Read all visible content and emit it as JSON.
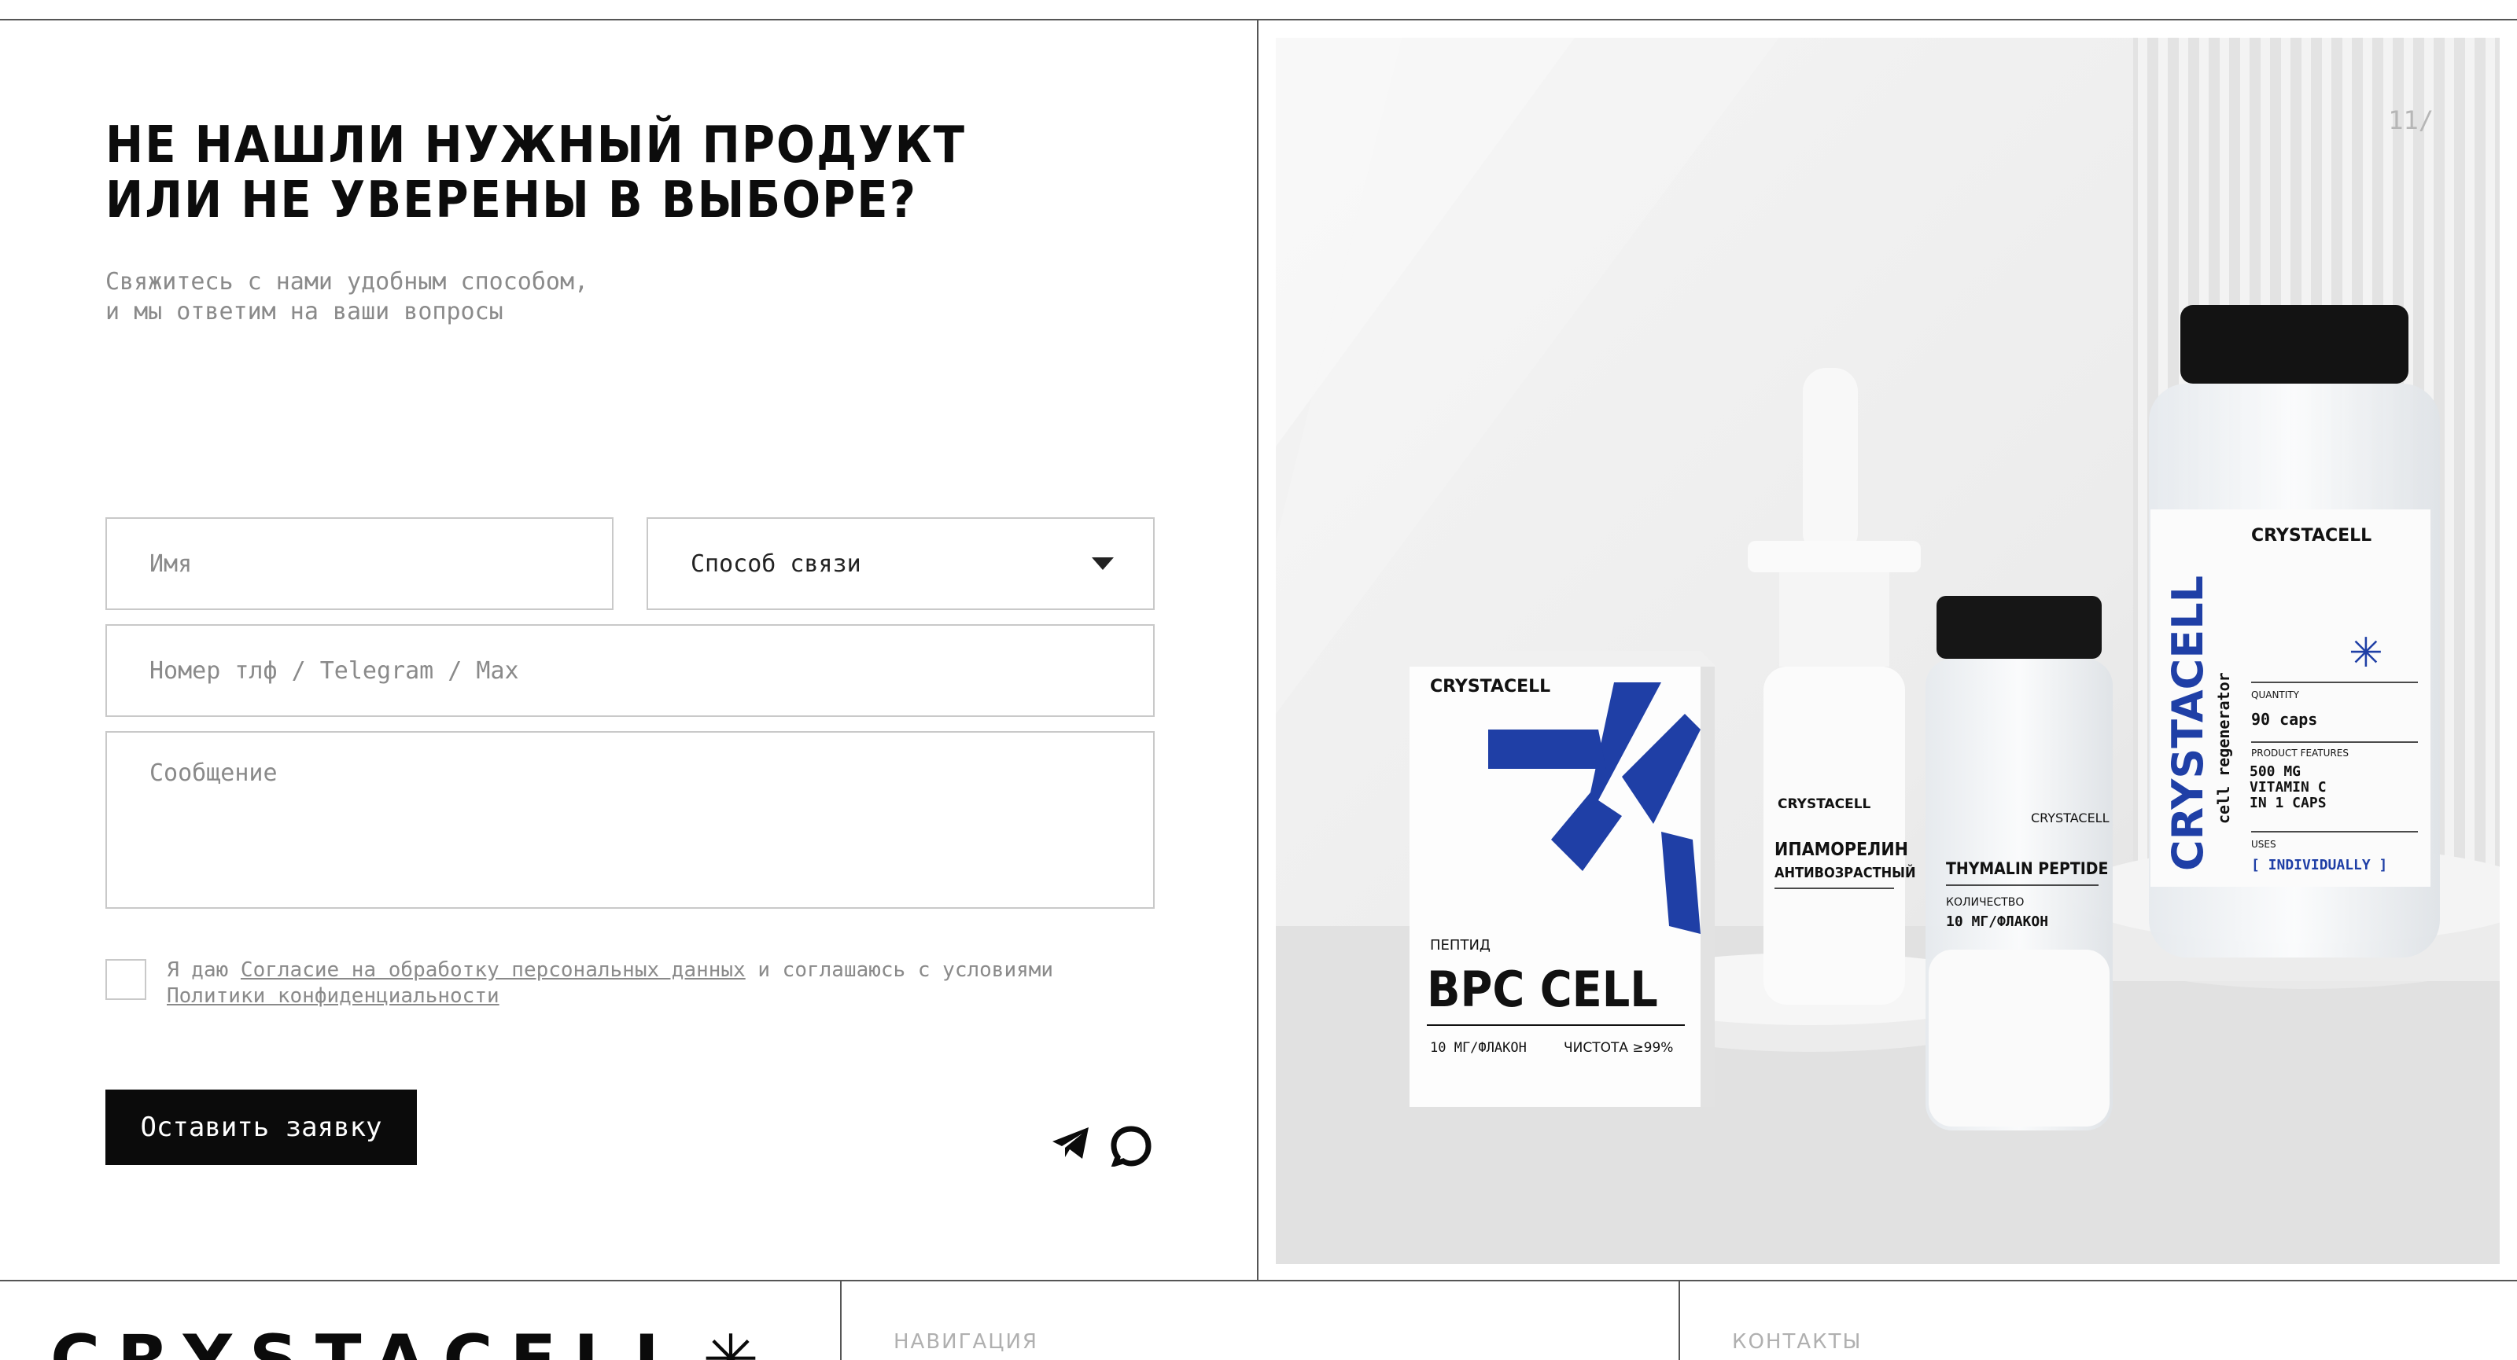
{
  "form": {
    "title_line1": "НЕ НАШЛИ НУЖНЫЙ ПРОДУКТ",
    "title_line2": "ИЛИ НЕ УВЕРЕНЫ В ВЫБОРЕ?",
    "subtitle_line1": "Свяжитесь с нами удобным способом,",
    "subtitle_line2": "и мы ответим на ваши вопросы",
    "name_placeholder": "Имя",
    "contact_method": "Способ связи",
    "phone_placeholder": "Номер тлф / Telegram / Max",
    "message_placeholder": "Сообщение",
    "consent_prefix": "Я даю ",
    "consent_link": "Согласие на обработку персональных данных",
    "consent_middle": " и соглашаюсь с условиями ",
    "privacy_link": "Политики конфиденциальности",
    "submit_label": "Оставить заявку"
  },
  "hero": {
    "page_number": "11/",
    "products": {
      "box_brand": "CRYSTACELL",
      "box_type": "ПЕПТИД",
      "box_name": "BPC CELL",
      "box_dose": "10 МГ/ФЛАКОН",
      "box_purity": "ЧИСТОТА ≥99%",
      "spray_brand": "CRYSTACELL",
      "spray_name_1": "ИПАМОРЕЛИН",
      "spray_name_2": "АНТИВОЗРАСТНЫЙ",
      "vial_brand": "CRYSTACELL",
      "vial_name": "THYMALIN PEPTIDE",
      "vial_qty_label": "КОЛИЧЕСТВО",
      "vial_qty": "10 МГ/ФЛАКОН",
      "jar_brand": "CRYSTACELL",
      "jar_vertical": "CRYSTACELL",
      "jar_sub": "cell regenerator",
      "jar_qty_label": "QUANTITY",
      "jar_qty": "90 caps",
      "jar_feat_label": "PRODUCT FEATURES",
      "jar_feat": "500 MG VITAMIN C IN 1 CAPS",
      "jar_uses_label": "USES",
      "jar_uses": "[ INDIVIDUALLY ]"
    }
  },
  "footer": {
    "logo": "CRYSTACELL",
    "nav_label": "НАВИГАЦИЯ",
    "contacts_label": "КОНТАКТЫ"
  },
  "colors": {
    "accent": "#1f3fa6",
    "dark": "#0b0b0b",
    "muted": "#8a8a8a"
  },
  "icons": [
    "chevron-down-icon",
    "telegram-icon",
    "max-messenger-icon",
    "star-icon"
  ]
}
